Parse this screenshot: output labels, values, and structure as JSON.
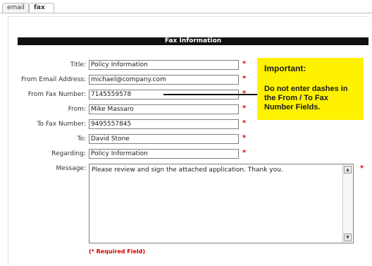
{
  "tabs": [
    {
      "label": "email"
    },
    {
      "label": "fax"
    }
  ],
  "section": {
    "title": "Fax Information"
  },
  "fields": {
    "title": {
      "label": "Title:",
      "value": "Policy Information"
    },
    "from_email": {
      "label": "From Email Address:",
      "value": "michael@company.com"
    },
    "from_fax": {
      "label": "From Fax Number:",
      "value": "7145559578"
    },
    "from": {
      "label": "From:",
      "value": "Mike Massaro"
    },
    "to_fax": {
      "label": "To Fax Number:",
      "value": "9495557845"
    },
    "to": {
      "label": "To:",
      "value": "David Stone"
    },
    "regarding": {
      "label": "Regarding:",
      "value": "Policy Information"
    },
    "message": {
      "label": "Message:",
      "value": "Please review and sign the attached application.  Thank you."
    }
  },
  "required_marker": "*",
  "required_note": "(* Required Field)",
  "callout": {
    "title": "Important:",
    "body": "Do not enter dashes in the From / To Fax Number Fields."
  },
  "colors": {
    "required": "#d40000",
    "callout_bg": "#fff200",
    "header_bg": "#111111"
  }
}
